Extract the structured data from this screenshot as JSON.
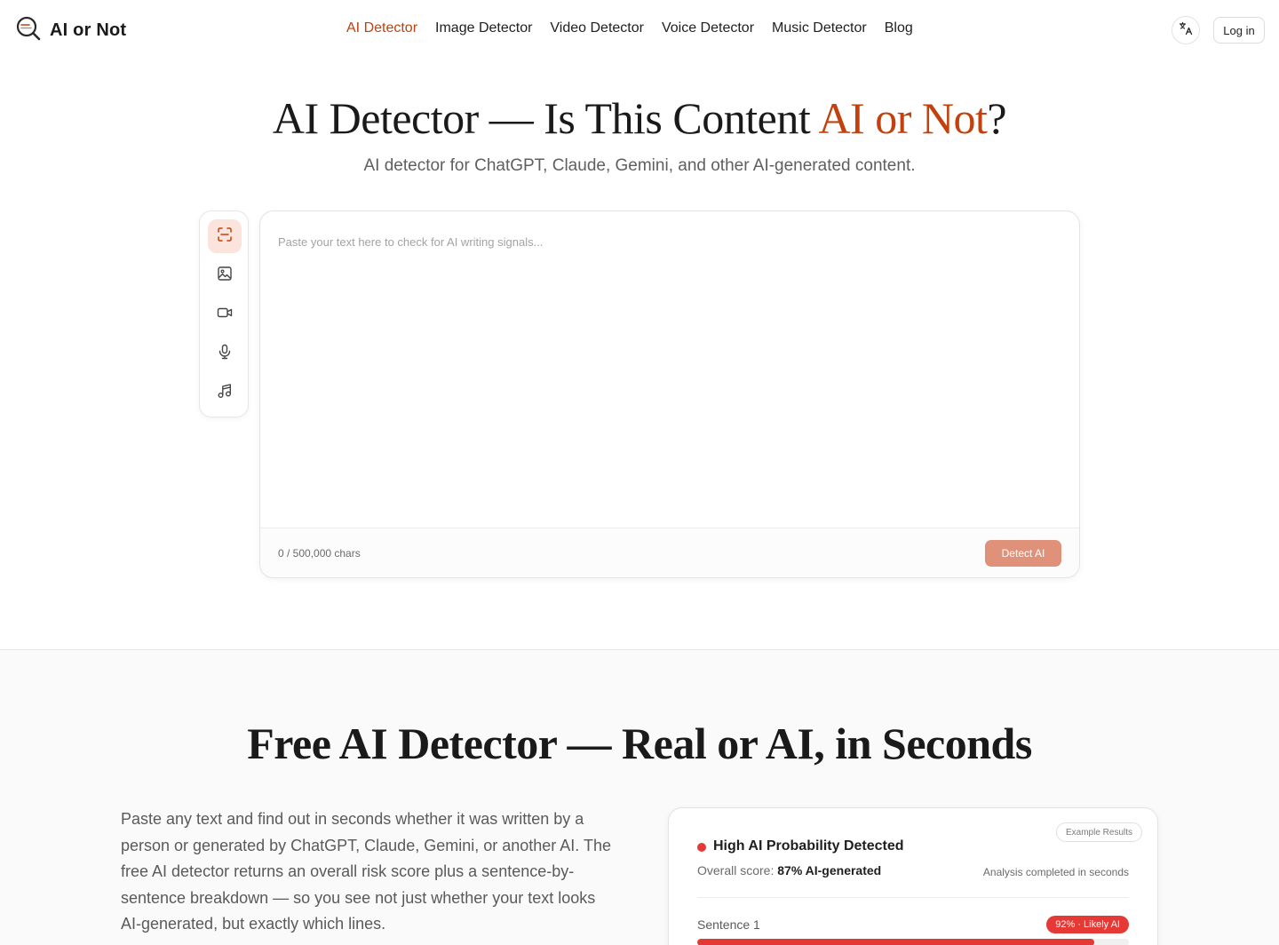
{
  "header": {
    "brand_name": "AI or Not",
    "nav": [
      {
        "label": "AI Detector",
        "active": true
      },
      {
        "label": "Image Detector",
        "active": false
      },
      {
        "label": "Video Detector",
        "active": false
      },
      {
        "label": "Voice Detector",
        "active": false
      },
      {
        "label": "Music Detector",
        "active": false
      },
      {
        "label": "Blog",
        "active": false
      }
    ],
    "language_icon": "translate-icon",
    "login_label": "Log in"
  },
  "hero": {
    "title_main": "AI Detector — Is This Content ",
    "title_accent": "AI or Not",
    "title_end": "?",
    "subtitle": "AI detector for ChatGPT, Claude, Gemini, and other AI-generated content."
  },
  "tool_rail": {
    "items": [
      {
        "icon": "scan-text-icon",
        "active": true
      },
      {
        "icon": "image-icon",
        "active": false
      },
      {
        "icon": "video-icon",
        "active": false
      },
      {
        "icon": "microphone-icon",
        "active": false
      },
      {
        "icon": "music-icon",
        "active": false
      }
    ]
  },
  "editor": {
    "placeholder": "Paste your text here to check for AI writing signals...",
    "value": "",
    "char_count": "0 / 500,000 chars",
    "detect_label": "Detect AI"
  },
  "section2": {
    "title": "Free AI Detector — Real or AI, in Seconds",
    "paragraph": "Paste any text and find out in seconds whether it was written by a person or generated by ChatGPT, Claude, Gemini, or another AI. The free AI detector returns an overall risk score plus a sentence-by-sentence breakdown — so you see not just whether your text looks AI-generated, but exactly which lines."
  },
  "result_card": {
    "badge": "Example Results",
    "status_title": "High AI Probability Detected",
    "overall_label": "Overall score: ",
    "overall_value": "87% AI-generated",
    "analysis_note": "Analysis completed in seconds",
    "sentence_label": "Sentence 1",
    "sentence_badge": "92% · Likely AI",
    "sentence_probability": 0.92
  },
  "colors": {
    "accent": "#c2410c",
    "detect_button": "#e0917a",
    "danger": "#e53935"
  }
}
